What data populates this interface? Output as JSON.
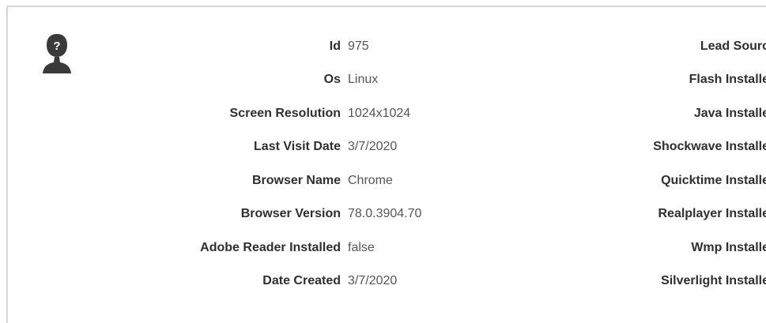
{
  "avatar_icon": "unknown-user-icon",
  "details": {
    "left": [
      {
        "label": "Id",
        "value": "975"
      },
      {
        "label": "Os",
        "value": "Linux"
      },
      {
        "label": "Screen Resolution",
        "value": "1024x1024"
      },
      {
        "label": "Last Visit Date",
        "value": "3/7/2020"
      },
      {
        "label": "Browser Name",
        "value": "Chrome"
      },
      {
        "label": "Browser Version",
        "value": "78.0.3904.70"
      },
      {
        "label": "Adobe Reader Installed",
        "value": "false"
      },
      {
        "label": "Date Created",
        "value": "3/7/2020"
      }
    ],
    "right": [
      {
        "label": "Lead Sourc"
      },
      {
        "label": "Flash Installe"
      },
      {
        "label": "Java Installe"
      },
      {
        "label": "Shockwave Installe"
      },
      {
        "label": "Quicktime Installe"
      },
      {
        "label": "Realplayer Installe"
      },
      {
        "label": "Wmp Installe"
      },
      {
        "label": "Silverlight Installe"
      }
    ]
  }
}
